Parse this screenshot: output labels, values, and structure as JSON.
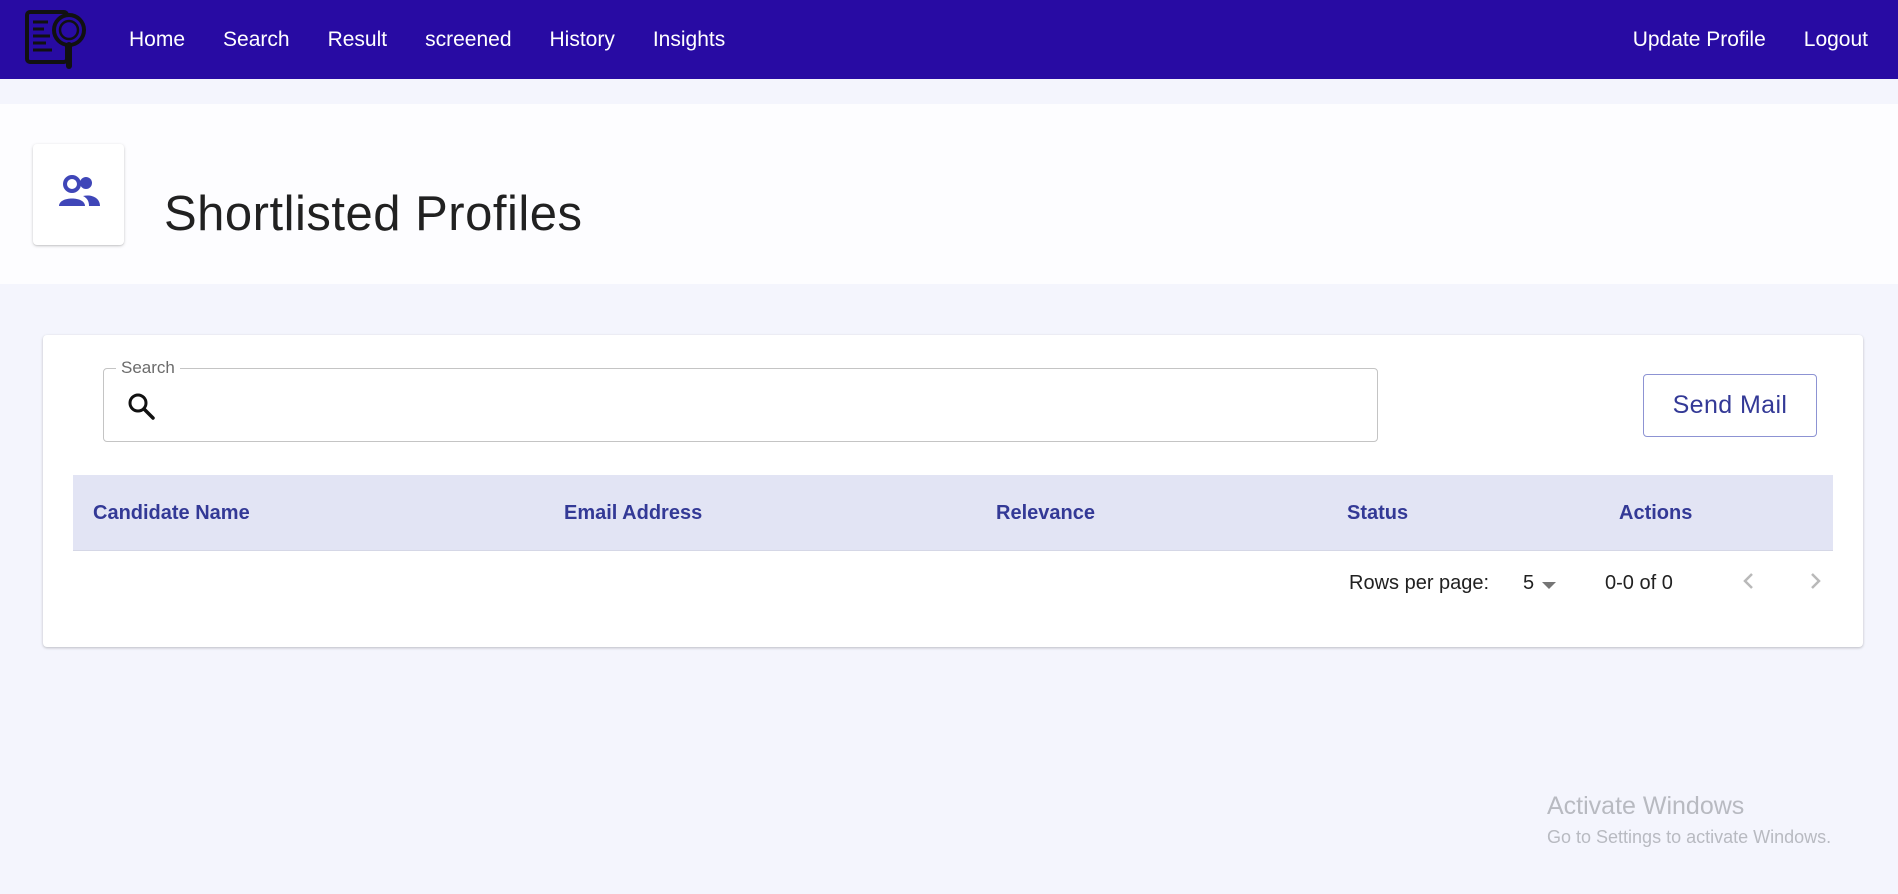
{
  "nav": {
    "links": [
      "Home",
      "Search",
      "Result",
      "screened",
      "History",
      "Insights"
    ],
    "right_links": [
      "Update Profile",
      "Logout"
    ],
    "bg_color": "#280ba3"
  },
  "header": {
    "icon": "people-icon",
    "title": "Shortlisted Profiles"
  },
  "search": {
    "legend": "Search",
    "value": "",
    "placeholder": ""
  },
  "send_mail_label": "Send Mail",
  "table": {
    "columns": [
      "Candidate Name",
      "Email Address",
      "Relevance",
      "Status",
      "Actions"
    ],
    "rows": []
  },
  "pagination": {
    "rows_per_page_label": "Rows per page:",
    "rows_per_page_value": "5",
    "range": "0-0 of 0"
  },
  "watermark": {
    "title": "Activate Windows",
    "subtitle": "Go to Settings to activate Windows."
  },
  "colors": {
    "accent": "#333996",
    "table_head_bg": "#e2e4f4",
    "page_bg": "#f4f5fd"
  }
}
